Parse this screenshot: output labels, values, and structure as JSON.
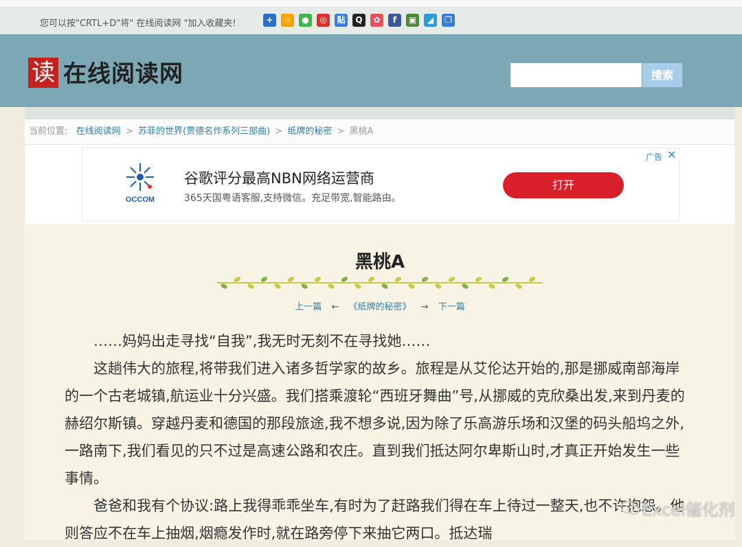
{
  "share_bar": {
    "text": "您可以按\"CRTL+D\"将\" 在线阅读网 \"加入收藏夹!",
    "icons": [
      {
        "name": "add-icon",
        "color": "#2a6fc9",
        "glyph": "+"
      },
      {
        "name": "star-icon",
        "color": "#f6a400",
        "glyph": "☆"
      },
      {
        "name": "wechat-icon",
        "color": "#3fb64a",
        "glyph": "●"
      },
      {
        "name": "weibo-icon",
        "color": "#e0302c",
        "glyph": "◎"
      },
      {
        "name": "tieba-icon",
        "color": "#3b7be0",
        "glyph": "贴"
      },
      {
        "name": "qq-icon",
        "color": "#222222",
        "glyph": "Q"
      },
      {
        "name": "flower-icon",
        "color": "#e8505b",
        "glyph": "✿"
      },
      {
        "name": "facebook-icon",
        "color": "#3b5998",
        "glyph": "f"
      },
      {
        "name": "doc-icon",
        "color": "#4c8a3c",
        "glyph": "▣"
      },
      {
        "name": "note-icon",
        "color": "#2a9fd6",
        "glyph": "◢"
      },
      {
        "name": "copy-icon",
        "color": "#3a7bd5",
        "glyph": "❐"
      }
    ]
  },
  "header": {
    "logo_char": "读",
    "site_name": "在线阅读网",
    "search_placeholder": "",
    "search_button": "搜索"
  },
  "breadcrumb": {
    "prefix": "当前位置:",
    "items": [
      "在线阅读网",
      "苏菲的世界(贾德名作系列三部曲)",
      "纸牌的秘密"
    ],
    "current": "黑桃A"
  },
  "ad": {
    "brand": "OCCOM",
    "title": "谷歌评分最高NBN网络运营商",
    "desc": "365天国粤语客服,支持微信。充足带宽,智能路由。",
    "button": "打开",
    "tag": "广告"
  },
  "article": {
    "title": "黑桃A",
    "prev": "上一篇",
    "book": "《纸牌的秘密》",
    "next": "下一篇",
    "paragraphs": [
      "……妈妈出走寻找“自我”,我无时无刻不在寻找她……",
      "这趟伟大的旅程,将带我们进入诸多哲学家的故乡。旅程是从艾伦达开始的,那是挪威南部海岸的一个古老城镇,航运业十分兴盛。我们搭乘渡轮“西班牙舞曲”号,从挪威的克欣桑出发,来到丹麦的赫绍尔斯镇。穿越丹麦和德国的那段旅途,我不想多说,因为除了乐高游乐场和汉堡的码头船坞之外,一路南下,我们看见的只不过是高速公路和农庄。直到我们抵达阿尔卑斯山时,才真正开始发生一些事情。",
      "爸爸和我有个协议:路上我得乖乖坐车,有时为了赶路我们得在车上待过一整天,也不许抱怨。他则答应不在车上抽烟,烟瘾发作时,就在路旁停下来抽它两口。抵达瑞"
    ]
  },
  "watermark": "Excel催化剂"
}
